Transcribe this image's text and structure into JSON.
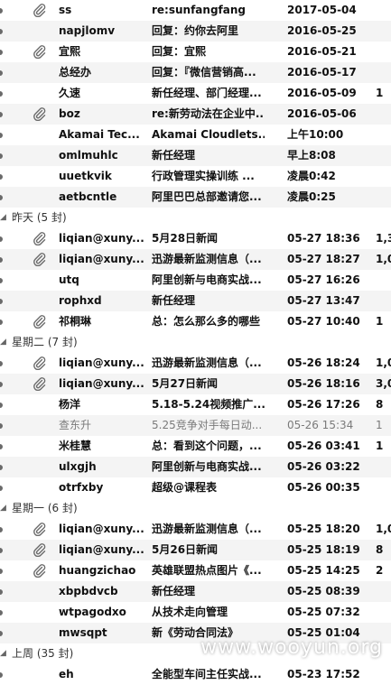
{
  "groups": [
    {
      "label": "",
      "emails": [
        {
          "sender": "ss",
          "subject": "re:sunfangfang",
          "date": "2017-05-04",
          "size": "",
          "attachment": true,
          "unread": true
        },
        {
          "sender": "napjlomv",
          "subject": "回复：约你去阿里",
          "date": "2016-05-25",
          "size": "",
          "attachment": false,
          "unread": true
        },
        {
          "sender": "宜熙",
          "subject": "回复：宜熙",
          "date": "2016-05-21",
          "size": "",
          "attachment": true,
          "unread": true
        },
        {
          "sender": "总经办",
          "subject": "回复：『微信营销高...",
          "date": "2016-05-17",
          "size": "",
          "attachment": false,
          "unread": true
        },
        {
          "sender": "久速",
          "subject": "新任经理、部门经理...",
          "date": "2016-05-09",
          "size": "1",
          "attachment": false,
          "unread": true
        },
        {
          "sender": "boz",
          "subject": "re:新劳动法在企业中...",
          "date": "2016-05-06",
          "size": "",
          "attachment": true,
          "unread": true
        },
        {
          "sender": "Akamai Tec...",
          "subject": "Akamai Cloudlets...",
          "date": "上午10:00",
          "size": "",
          "attachment": false,
          "unread": true
        },
        {
          "sender": "omlmuhlc",
          "subject": "新任经理",
          "date": "早上8:08",
          "size": "",
          "attachment": false,
          "unread": true
        },
        {
          "sender": "uuetkvik",
          "subject": "行政管理实操训练 ...",
          "date": "凌晨0:42",
          "size": "",
          "attachment": false,
          "unread": true
        },
        {
          "sender": "aetbcntle",
          "subject": "阿里巴巴总部邀请您...",
          "date": "凌晨0:25",
          "size": "",
          "attachment": false,
          "unread": true
        }
      ]
    },
    {
      "label": "昨天 (5 封)",
      "emails": [
        {
          "sender": "liqian@xuny...",
          "subject": "5月28日新闻",
          "date": "05-27 18:36",
          "size": "1,3",
          "attachment": true,
          "unread": true
        },
        {
          "sender": "liqian@xuny...",
          "subject": "迅游最新监测信息（...",
          "date": "05-27 18:27",
          "size": "1,0",
          "attachment": true,
          "unread": true
        },
        {
          "sender": "utq",
          "subject": "阿里创新与电商实战...",
          "date": "05-27 16:26",
          "size": "",
          "attachment": false,
          "unread": true
        },
        {
          "sender": "rophxd",
          "subject": "新任经理",
          "date": "05-27 13:47",
          "size": "",
          "attachment": false,
          "unread": true
        },
        {
          "sender": "祁桐琳",
          "subject": "总：怎么那么多的哪些",
          "date": "05-27 10:40",
          "size": "1",
          "attachment": true,
          "unread": true
        }
      ]
    },
    {
      "label": "星期二 (7 封)",
      "emails": [
        {
          "sender": "liqian@xuny...",
          "subject": "迅游最新监测信息（...",
          "date": "05-26 18:24",
          "size": "1,0",
          "attachment": true,
          "unread": true
        },
        {
          "sender": "liqian@xuny...",
          "subject": "5月27日新闻",
          "date": "05-26 18:16",
          "size": "3,0",
          "attachment": true,
          "unread": true
        },
        {
          "sender": "杨洋",
          "subject": "5.18-5.24视频推广...",
          "date": "05-26 17:26",
          "size": "8",
          "attachment": false,
          "unread": true
        },
        {
          "sender": "查东升",
          "subject": "5.25竞争对手每日动...",
          "date": "05-26 15:34",
          "size": "1",
          "attachment": false,
          "unread": false
        },
        {
          "sender": "米桂慧",
          "subject": "总：看到这个问题，...",
          "date": "05-26 03:41",
          "size": "1",
          "attachment": false,
          "unread": true
        },
        {
          "sender": "ulxgjh",
          "subject": "阿里创新与电商实战...",
          "date": "05-26 03:22",
          "size": "",
          "attachment": false,
          "unread": true
        },
        {
          "sender": "otrfxby",
          "subject": "超级@课程表",
          "date": "05-26 00:35",
          "size": "",
          "attachment": false,
          "unread": true
        }
      ]
    },
    {
      "label": "星期一 (6 封)",
      "emails": [
        {
          "sender": "liqian@xuny...",
          "subject": "迅游最新监测信息（...",
          "date": "05-25 18:20",
          "size": "1,0",
          "attachment": true,
          "unread": true
        },
        {
          "sender": "liqian@xuny...",
          "subject": "5月26日新闻",
          "date": "05-25 18:19",
          "size": "8",
          "attachment": true,
          "unread": true
        },
        {
          "sender": "huangzichao",
          "subject": "英雄联盟热点图片《...",
          "date": "05-25 14:25",
          "size": "2",
          "attachment": true,
          "unread": true
        },
        {
          "sender": "xbpbdvcb",
          "subject": "新任经理",
          "date": "05-25 08:39",
          "size": "",
          "attachment": false,
          "unread": true
        },
        {
          "sender": "wtpagodxo",
          "subject": "从技术走向管理",
          "date": "05-25 07:32",
          "size": "",
          "attachment": false,
          "unread": true
        },
        {
          "sender": "mwsqpt",
          "subject": "新《劳动合同法》",
          "date": "05-25 01:04",
          "size": "",
          "attachment": false,
          "unread": true
        }
      ]
    },
    {
      "label": "上周 (35 封)",
      "emails": [
        {
          "sender": "eh",
          "subject": "全能型车间主任实战...",
          "date": "05-23 17:52",
          "size": "",
          "attachment": false,
          "unread": true
        }
      ]
    }
  ],
  "watermark": "www.wooyun.org"
}
